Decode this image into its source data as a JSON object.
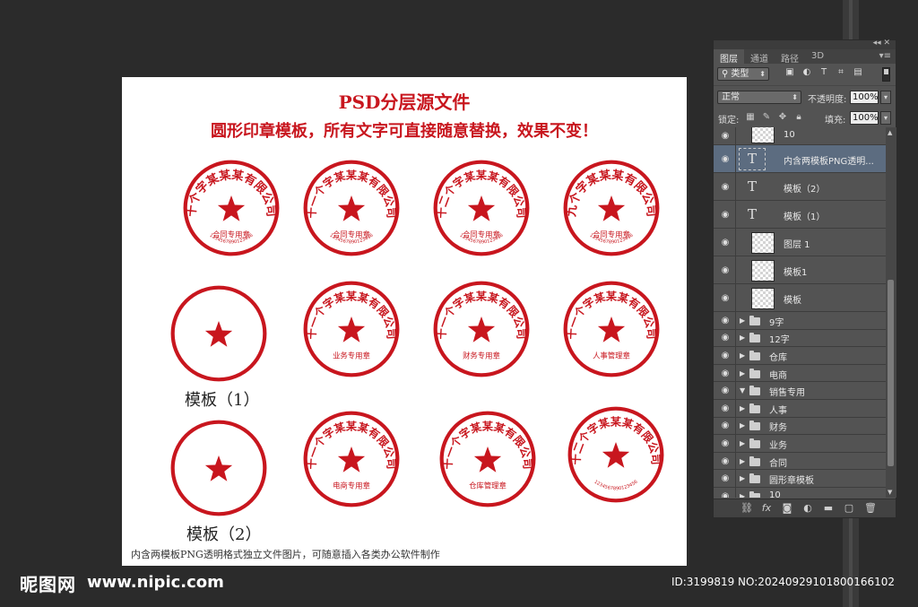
{
  "document": {
    "title": "PSD分层源文件",
    "subtitle": "圆形印章模板，所有文字可直接随意替换，效果不变！",
    "template1_label": "模板（1）",
    "template2_label": "模板（2）",
    "footer_note": "内含两模板PNG透明格式独立文件图片，可随意插入各类办公软件制作"
  },
  "seals": [
    {
      "company": "十个字某某某有限公司",
      "dept": "合同专用章",
      "code": "1234567890123456"
    },
    {
      "company": "十一个字某某某有限公司",
      "dept": "合同专用章",
      "code": "1234567890123456"
    },
    {
      "company": "十二个字某某某有限公司",
      "dept": "合同专用章",
      "code": "1234567890123456"
    },
    {
      "company": "九个字某某某有限公司",
      "dept": "合同专用章",
      "code": "1234567890123456"
    },
    {
      "company": "",
      "dept": "",
      "code": ""
    },
    {
      "company": "十一个字某某某有限公司",
      "dept": "业务专用章",
      "code": ""
    },
    {
      "company": "十一个字某某某有限公司",
      "dept": "财务专用章",
      "code": ""
    },
    {
      "company": "十一个字某某某有限公司",
      "dept": "人事管理章",
      "code": ""
    },
    {
      "company": "",
      "dept": "",
      "code": ""
    },
    {
      "company": "十一个字某某某有限公司",
      "dept": "电商专用章",
      "code": ""
    },
    {
      "company": "十一个字某某某有限公司",
      "dept": "仓库管理章",
      "code": ""
    },
    {
      "company": "十二个字某某某有限公司",
      "dept": "",
      "code": "1234567890123456"
    }
  ],
  "colors": {
    "seal_red": "#c8161e",
    "panel_bg": "#535353",
    "selected_row": "#5c6c80"
  },
  "panel": {
    "tabs": [
      "图层",
      "通道",
      "路径",
      "3D"
    ],
    "filter_kind": "类型",
    "blend_mode": "正常",
    "opacity_label": "不透明度:",
    "opacity_value": "100%",
    "lock_label": "锁定:",
    "fill_label": "填充:",
    "fill_value": "100%",
    "layers": [
      {
        "name": "10",
        "type": "pixel",
        "selected": false
      },
      {
        "name": "内含两模板PNG透明...",
        "type": "text",
        "selected": true
      },
      {
        "name": "模板（2）",
        "type": "text",
        "selected": false
      },
      {
        "name": "模板（1）",
        "type": "text",
        "selected": false
      },
      {
        "name": "图层 1",
        "type": "pixel",
        "selected": false
      },
      {
        "name": "模板1",
        "type": "pixel",
        "selected": false
      },
      {
        "name": "模板",
        "type": "pixel",
        "selected": false
      },
      {
        "name": "9字",
        "type": "group",
        "expanded": false
      },
      {
        "name": "12字",
        "type": "group",
        "expanded": false
      },
      {
        "name": "仓库",
        "type": "group",
        "expanded": false
      },
      {
        "name": "电商",
        "type": "group",
        "expanded": false
      },
      {
        "name": "销售专用",
        "type": "group",
        "expanded": true
      },
      {
        "name": "人事",
        "type": "group",
        "expanded": false
      },
      {
        "name": "财务",
        "type": "group",
        "expanded": false
      },
      {
        "name": "业务",
        "type": "group",
        "expanded": false
      },
      {
        "name": "合同",
        "type": "group",
        "expanded": false
      },
      {
        "name": "圆形章模板",
        "type": "group",
        "expanded": false
      },
      {
        "name": "10",
        "type": "group",
        "expanded": false
      }
    ],
    "bottom_icons": [
      "link-icon",
      "fx-icon",
      "mask-icon",
      "adjustment-icon",
      "group-icon",
      "new-layer-icon",
      "trash-icon"
    ]
  },
  "watermark": {
    "logo": "昵图网",
    "url": "www.nipic.com",
    "id_text": "ID:3199819 NO:20240929101800166102"
  }
}
